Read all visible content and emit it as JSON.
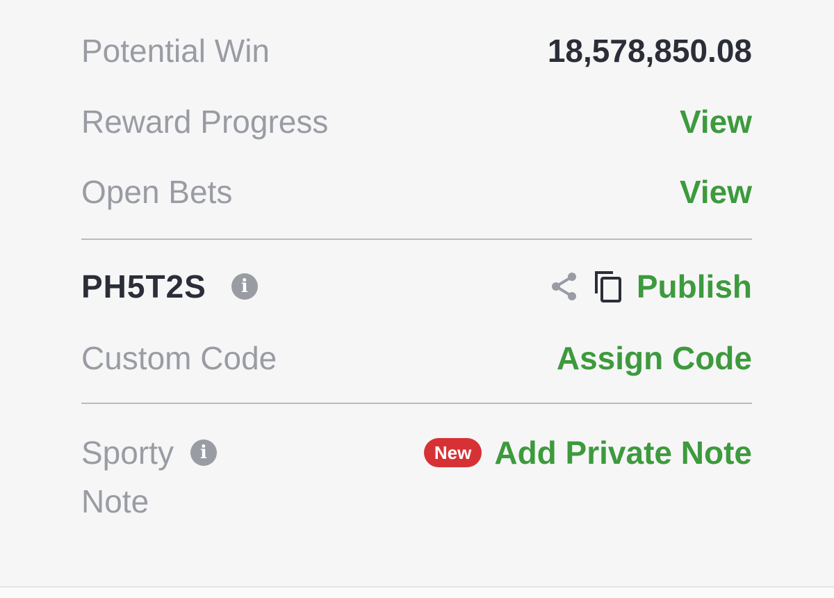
{
  "summary": {
    "potential_win_label": "Potential Win",
    "potential_win_value": "18,578,850.08",
    "reward_progress_label": "Reward Progress",
    "reward_progress_link": "View",
    "open_bets_label": "Open Bets",
    "open_bets_link": "View"
  },
  "booking": {
    "code": "PH5T2S",
    "info_icon": "i",
    "share_icon": "share-icon",
    "copy_icon": "copy-icon",
    "publish_label": "Publish",
    "custom_code_label": "Custom Code",
    "assign_code_label": "Assign Code"
  },
  "note": {
    "label_line1": "Sporty",
    "label_line2": "Note",
    "info_icon": "i",
    "badge": "New",
    "add_label": "Add Private Note"
  },
  "colors": {
    "link_green": "#3d9a3d",
    "label_gray": "#9a9ca3",
    "dark_text": "#2b2e38",
    "badge_red": "#d63235",
    "background": "#f6f6f7"
  }
}
